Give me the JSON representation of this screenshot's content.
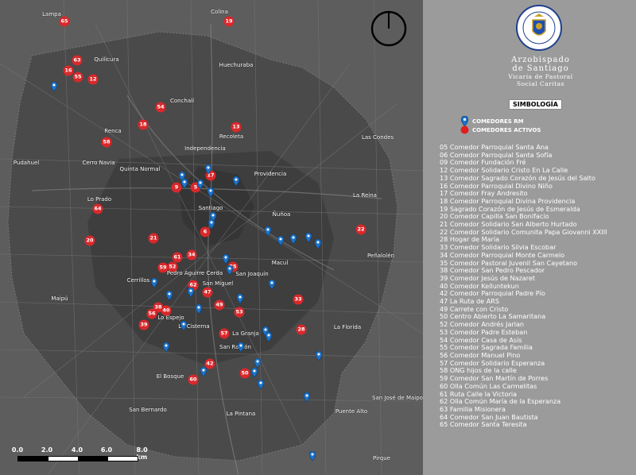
{
  "map": {
    "places": [
      "Lampa",
      "Colina",
      "Quilicura",
      "Huechuraba",
      "Conchalí",
      "Renca",
      "Recoleta",
      "Independencia",
      "Las Condes",
      "Pudahuel",
      "Cerro Navia",
      "Quinta Normal",
      "Providencia",
      "Lo Prado",
      "Santiago",
      "La Reina",
      "Ñuñoa",
      "Peñalolén",
      "Pedro Aguirre Cerda",
      "Macul",
      "San Joaquín",
      "Cerrillos",
      "San Miguel",
      "Maipú",
      "Lo Espejo",
      "La Cisterna",
      "La Granja",
      "La Florida",
      "San Ramón",
      "El Bosque",
      "San Bernardo",
      "La Pintana",
      "Puente Alto",
      "San José de Maipo",
      "Pirque"
    ],
    "active_markers": [
      "65",
      "19",
      "63",
      "16",
      "55",
      "12",
      "54",
      "18",
      "13",
      "58",
      "17",
      "9",
      "5",
      "64",
      "20",
      "21",
      "6",
      "22",
      "61",
      "34",
      "52",
      "59",
      "35",
      "62",
      "47",
      "33",
      "38",
      "40",
      "56",
      "49",
      "53",
      "39",
      "28",
      "57",
      "42",
      "50",
      "60"
    ],
    "pin_count": 34,
    "scale_labels": [
      "0.0",
      "2.0",
      "4.0",
      "6.0",
      "8.0 km"
    ]
  },
  "org": {
    "line1": "Arzobispado",
    "line2": "de Santiago",
    "line3": "Vicaría de Pastoral",
    "line4": "Social Caritas",
    "seal_text": "ARZOBISPADO DE SANTIAGO CHILE"
  },
  "legend": {
    "title": "SIMBOLOGÍA",
    "items": [
      {
        "label": "COMEDORES RM",
        "color": "#1e73c8",
        "icon": "pin-icon"
      },
      {
        "label": "COMEDORES ACTIVOS",
        "color": "#e01e1e",
        "icon": "circle-icon"
      }
    ]
  },
  "list": [
    "05 Comedor Parroquial Santa Ana",
    "06 Comedor Parroquial Santa Sofía",
    "09 Comedor Fundación Fré",
    "12 Comedor Solidario Cristo En La Calle",
    "13 Comedor Sagrado Corazón de Jesús del Salto",
    "16 Comedor Parroquial Divino Niño",
    "17 Comedor Fray Andresito",
    "18 Comedor Parroquial Divina Providencia",
    "19 Sagrado Corazón de Jesús de Esmeralda",
    "20 Comedor Capilla San Bonifacio",
    "21 Comedor Solidario San Alberto Hurtado",
    "22 Comedor Solidario Comunita Papa Giovanni XXIII",
    "28 Hogar de María",
    "33 Comedor Solidario Silvia Escobar",
    "34 Comedor Parroquial Monte Carmelo",
    "35 Comedor Pastoral Juvenil San Cayetano",
    "38 Comedor San Pedro Pescador",
    "39 Comedor Jesús de Nazaret",
    "40 Comedor Kelluntekun",
    "42 Comedor Parroquial Padre Pío",
    "47 La Ruta de ARS",
    "49 Carrete con Cristo",
    "50 Centro Abierto La Samaritana",
    "52 Comedor Andrés Jarlan",
    "53 Comedor Padre Esteban",
    "54 Comedor Casa de Asís",
    "55 Comedor Sagrada Familia",
    "56 Comedor Manuel Pino",
    "57 Comedor Solidario Esperanza",
    "58 ONG hijos de la calle",
    "59 Comedor San Martín de Porres",
    "60 Olla Común Las Carmelitas",
    "61 Ruta Calle la Victoria",
    "62 Olla Común María de la Esperanza",
    "63 Familia Misionera",
    "64 Comedor San Juan Bautista",
    "65 Comedor Santa Teresita"
  ]
}
